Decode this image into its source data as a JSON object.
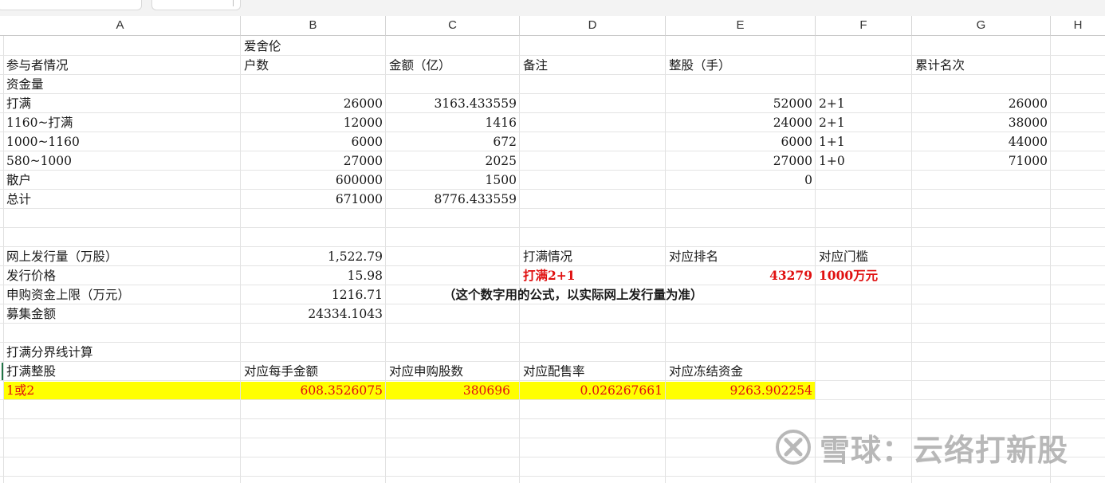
{
  "columns": [
    "A",
    "B",
    "C",
    "D",
    "E",
    "F",
    "G",
    "H"
  ],
  "header_row": {
    "b_top": "爱舍伦",
    "a": "参与者情况",
    "b": "户数",
    "c": "金额（亿）",
    "d": "备注",
    "e": "整股（手）",
    "g": "累计名次"
  },
  "section1_label": "资金量",
  "tiers": [
    {
      "a": "打满",
      "b": "26000",
      "c": "3163.433559",
      "e": "52000",
      "f": "2+1",
      "g": "26000"
    },
    {
      "a": "1160~打满",
      "b": "12000",
      "c": "1416",
      "e": "24000",
      "f": "2+1",
      "g": "38000"
    },
    {
      "a": "1000~1160",
      "b": "6000",
      "c": "672",
      "e": "6000",
      "f": "1+1",
      "g": "44000"
    },
    {
      "a": "580~1000",
      "b": "27000",
      "c": "2025",
      "e": "27000",
      "f": "1+0",
      "g": "71000"
    },
    {
      "a": "散户",
      "b": "600000",
      "c": "1500",
      "e": "0",
      "f": "",
      "g": ""
    },
    {
      "a": "总计",
      "b": "671000",
      "c": "8776.433559",
      "e": "",
      "f": "",
      "g": ""
    }
  ],
  "issue": {
    "online_label": "网上发行量（万股）",
    "online_value": "1,522.79",
    "price_label": "发行价格",
    "price_value": "15.98",
    "cap_label": "申购资金上限（万元）",
    "cap_value": "1216.71",
    "raise_label": "募集金额",
    "raise_value": "24334.1043"
  },
  "result": {
    "d_label": "打满情况",
    "e_label": "对应排名",
    "f_label": "对应门槛",
    "d_value": "打满2+1",
    "e_value": "43279",
    "f_value": "1000万元",
    "note": "（这个数字用的公式，以实际网上发行量为准）"
  },
  "calc": {
    "title": "打满分界线计算",
    "headers": [
      "打满整股",
      "对应每手金额",
      "对应申购股数",
      "对应配售率",
      "对应冻结资金"
    ],
    "row": [
      "1或2",
      "608.3526075",
      "380696",
      "0.026267661",
      "9263.902254"
    ]
  },
  "watermark": {
    "text": "雪球：云络打新股",
    "icon": "snowball-logo-icon"
  },
  "colors": {
    "highlight": "#ffff00",
    "red": "#e01010",
    "grid": "#e1e1e1"
  }
}
